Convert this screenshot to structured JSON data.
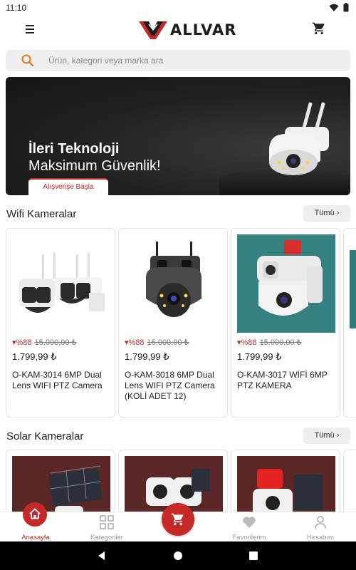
{
  "status_bar": {
    "time": "11:10"
  },
  "app": {
    "brand": "ALLVAR",
    "brand_color": "#c62828"
  },
  "search": {
    "placeholder": "Ürün, kategori veya marka ara"
  },
  "banner": {
    "line1": "İleri Teknoloji",
    "line2": "Maksimum Güvenlik!",
    "cta": "Alışverişe Başla"
  },
  "sections": [
    {
      "title": "Wifi Kameralar",
      "see_all": "Tümü ›",
      "products": [
        {
          "discount": "%88",
          "old_price": "15.000,00 ₺",
          "price": "1.799,99 ₺",
          "name": "O-KAM-3014 6MP Dual Lens WIFI PTZ Camera"
        },
        {
          "discount": "%88",
          "old_price": "15.000,00 ₺",
          "price": "1.799,99 ₺",
          "name": "O-KAM-3018 6MP Dual Lens WIFI PTZ Camera (KOLİ ADET 12)"
        },
        {
          "discount": "%88",
          "old_price": "15.000,00 ₺",
          "price": "1.799,99 ₺",
          "name": "O-KAM-3017 WİFİ 6MP PTZ KAMERA"
        }
      ]
    },
    {
      "title": "Solar Kameralar",
      "see_all": "Tümü ›"
    }
  ],
  "bottom_nav": [
    {
      "label": "Anasayfa",
      "icon": "home-icon",
      "active": true
    },
    {
      "label": "Kategoriler",
      "icon": "grid-icon",
      "active": false
    },
    {
      "label": "",
      "icon": "cart-icon",
      "active": false
    },
    {
      "label": "Favorilerim",
      "icon": "heart-icon",
      "active": false
    },
    {
      "label": "Hesabım",
      "icon": "person-icon",
      "active": false
    }
  ]
}
